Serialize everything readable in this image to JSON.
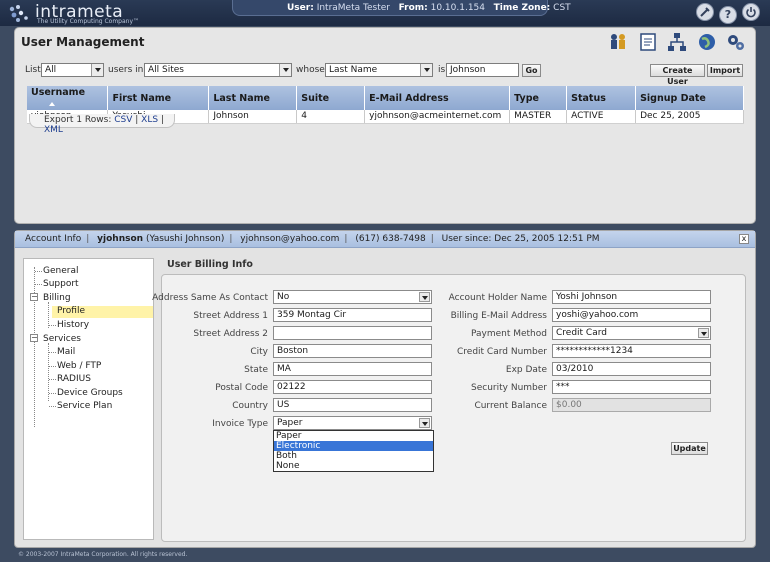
{
  "app": {
    "logo_text": "intrameta",
    "logo_tagline": "The Utility Computing Company™"
  },
  "userinfo": {
    "user_label": "User:",
    "user_value": "IntraMeta Tester",
    "from_label": "From:",
    "from_value": "10.10.1.154",
    "tz_label": "Time Zone:",
    "tz_value": "CST"
  },
  "page": {
    "title": "User Management"
  },
  "filter": {
    "list_label": "List",
    "list_value": "All",
    "users_in_label": "users in",
    "sites_value": "All Sites",
    "whose_label": "whose",
    "field_value": "Last Name",
    "is_label": "is",
    "search_value": "Johnson",
    "go_label": "Go",
    "create_user_label": "Create User",
    "import_label": "Import"
  },
  "grid": {
    "headers": [
      "Username",
      "First Name",
      "Last Name",
      "Suite",
      "E-Mail Address",
      "Type",
      "Status",
      "Signup Date"
    ],
    "rows": [
      [
        "yjohnson",
        "Yasushi",
        "Johnson",
        "4",
        "yjohnson@acmeinternet.com",
        "MASTER",
        "ACTIVE",
        "Dec 25, 2005"
      ]
    ],
    "export_prefix": "Export 1 Rows:",
    "export_csv": "CSV",
    "export_xls": "XLS",
    "export_xml": "XML"
  },
  "account": {
    "info_label": "Account Info",
    "username": "yjohnson",
    "fullname": "(Yasushi Johnson)",
    "email": "yjohnson@yahoo.com",
    "phone": "(617) 638-7498",
    "since": "User since: Dec 25, 2005 12:51 PM",
    "close_label": "x"
  },
  "tree": {
    "general": "General",
    "support": "Support",
    "billing": "Billing",
    "profile": "Profile",
    "history": "History",
    "services": "Services",
    "mail": "Mail",
    "web_ftp": "Web / FTP",
    "radius": "RADIUS",
    "device_groups": "Device Groups",
    "service_plan": "Service Plan",
    "toggle_minus": "−"
  },
  "billing": {
    "section_title": "User Billing Info",
    "address_same_label": "Address Same As Contact",
    "address_same_value": "No",
    "street1_label": "Street Address 1",
    "street1_value": "359 Montag Cir",
    "street2_label": "Street Address 2",
    "street2_value": "",
    "city_label": "City",
    "city_value": "Boston",
    "state_label": "State",
    "state_value": "MA",
    "postal_label": "Postal Code",
    "postal_value": "02122",
    "country_label": "Country",
    "country_value": "US",
    "invoice_label": "Invoice Type",
    "invoice_value": "Paper",
    "invoice_options": [
      "Paper",
      "Electronic",
      "Both",
      "None"
    ],
    "holder_label": "Account Holder Name",
    "holder_value": "Yoshi Johnson",
    "bill_email_label": "Billing E-Mail Address",
    "bill_email_value": "yoshi@yahoo.com",
    "payment_label": "Payment Method",
    "payment_value": "Credit Card",
    "cc_label": "Credit Card Number",
    "cc_value": "************1234",
    "exp_label": "Exp Date",
    "exp_value": "03/2010",
    "sec_label": "Security Number",
    "sec_value": "***",
    "balance_label": "Current Balance",
    "balance_value": "$0.00",
    "update_label": "Update"
  },
  "footer": {
    "copyright": "© 2003-2007 IntraMeta Corporation.  All rights reserved."
  }
}
